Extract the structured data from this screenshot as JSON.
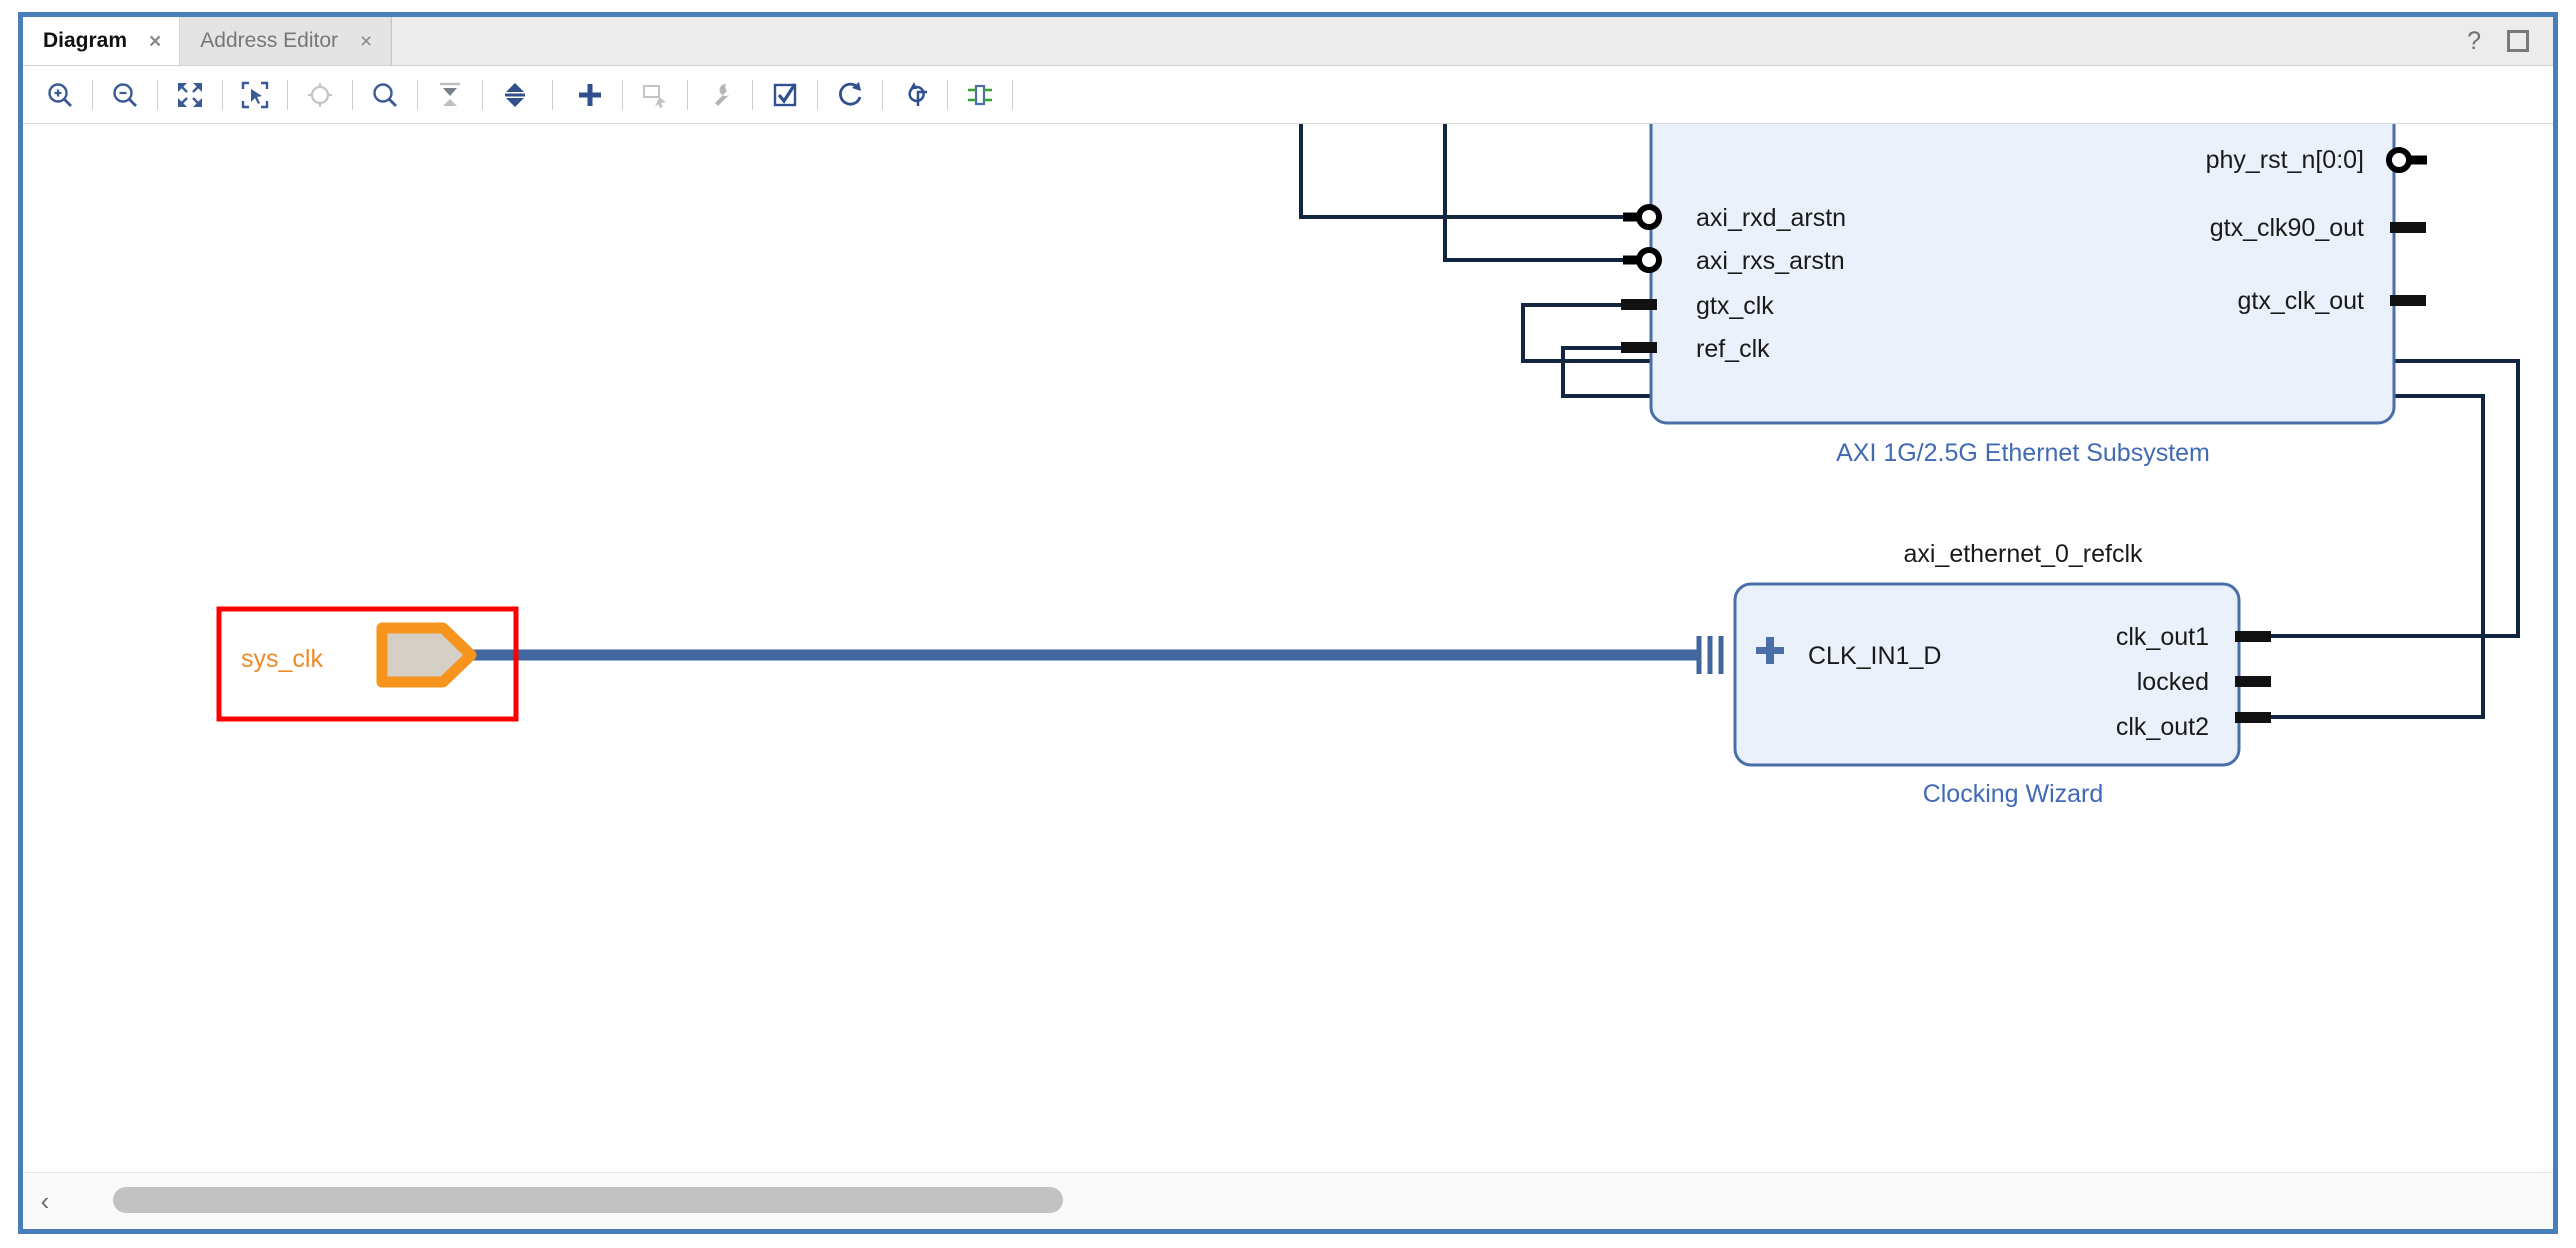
{
  "window": {
    "tabs": [
      {
        "label": "Diagram",
        "active": true,
        "close": "×"
      },
      {
        "label": "Address Editor",
        "active": false,
        "close": "×"
      }
    ],
    "help_glyph": "?",
    "maximize_name": "maximize-button"
  },
  "toolbar": {
    "buttons": [
      {
        "name": "zoom-in-icon",
        "title": "Zoom In",
        "enabled": true
      },
      {
        "name": "zoom-out-icon",
        "title": "Zoom Out",
        "enabled": true
      },
      {
        "name": "zoom-fit-icon",
        "title": "Zoom Fit",
        "enabled": true
      },
      {
        "name": "zoom-area-icon",
        "title": "Zoom Area",
        "enabled": true
      },
      {
        "name": "focus-selection-icon",
        "title": "Fit Selection",
        "enabled": false
      },
      {
        "name": "search-icon",
        "title": "Search",
        "enabled": true
      },
      {
        "name": "collapse-all-icon",
        "title": "Collapse All",
        "enabled": false
      },
      {
        "name": "expand-all-icon",
        "title": "Expand All",
        "enabled": true
      },
      {
        "name": "add-ip-icon",
        "title": "Add IP",
        "enabled": true
      },
      {
        "name": "add-module-icon",
        "title": "Add Module",
        "enabled": false
      },
      {
        "name": "run-connection-automation-icon",
        "title": "Run Connection Automation",
        "enabled": false
      },
      {
        "name": "validate-design-icon",
        "title": "Validate Design",
        "enabled": true
      },
      {
        "name": "refresh-icon",
        "title": "Refresh",
        "enabled": true
      },
      {
        "name": "regenerate-layout-icon",
        "title": "Regenerate Layout",
        "enabled": true
      },
      {
        "name": "optimize-routing-icon",
        "title": "Optimize Routing",
        "enabled": true
      }
    ]
  },
  "diagram": {
    "external_ports": [
      {
        "id": "sys_clk",
        "label": "sys_clk",
        "kind": "input",
        "selected": true
      }
    ],
    "blocks": [
      {
        "id": "axi_ethernet",
        "instance_name": "",
        "type_label": "AXI 1G/2.5G Ethernet Subsystem",
        "inputs": [
          {
            "label": "axi_rxd_arstn",
            "style": "inverted"
          },
          {
            "label": "axi_rxs_arstn",
            "style": "inverted"
          },
          {
            "label": "gtx_clk",
            "style": "pin"
          },
          {
            "label": "ref_clk",
            "style": "pin"
          }
        ],
        "outputs": [
          {
            "label": "phy_rst_n[0:0]",
            "style": "inverted",
            "clipped": true
          },
          {
            "label": "gtx_clk90_out",
            "style": "pin"
          },
          {
            "label": "gtx_clk_out",
            "style": "pin"
          }
        ]
      },
      {
        "id": "clk_wiz",
        "instance_name": "axi_ethernet_0_refclk",
        "type_label": "Clocking Wizard",
        "inputs": [
          {
            "label": "CLK_IN1_D",
            "style": "bus",
            "expander": "+"
          }
        ],
        "outputs": [
          {
            "label": "clk_out1",
            "style": "pin"
          },
          {
            "label": "locked",
            "style": "pin"
          },
          {
            "label": "clk_out2",
            "style": "pin"
          }
        ]
      }
    ],
    "colors": {
      "block_fill": "#eaf1fb",
      "block_border": "#4a6fa8",
      "block_type_text": "#4169b5",
      "wire": "#12263f",
      "bus_wire": "#41679e",
      "external_port_fill": "#d6cfc6",
      "external_port_border": "#f7941e",
      "external_port_text": "#f08a28",
      "selection": "#ff0000",
      "frame": "#4a7ebb"
    }
  },
  "scrollbar": {
    "left_chevron": "‹"
  }
}
